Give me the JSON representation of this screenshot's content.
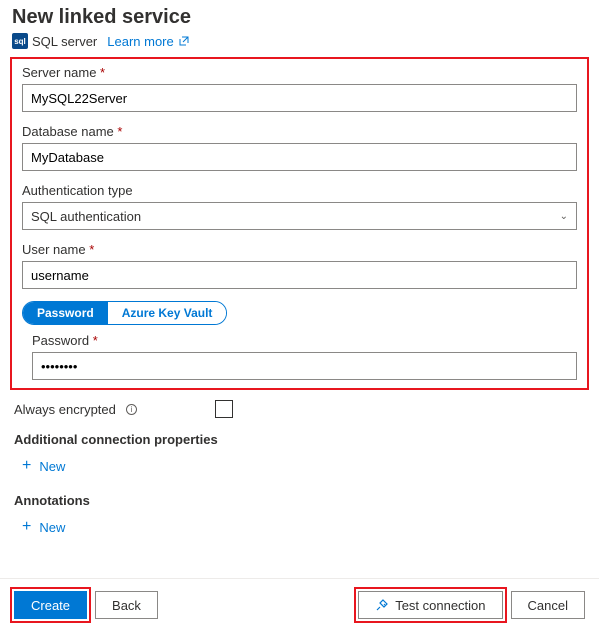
{
  "header": {
    "title": "New linked service",
    "subtitle": "SQL server",
    "learn_more": "Learn more"
  },
  "fields": {
    "server_name": {
      "label": "Server name",
      "value": "MySQL22Server"
    },
    "database_name": {
      "label": "Database name",
      "value": "MyDatabase"
    },
    "auth_type": {
      "label": "Authentication type",
      "value": "SQL authentication"
    },
    "user_name": {
      "label": "User name",
      "value": "username"
    },
    "password_tab": "Password",
    "akv_tab": "Azure Key Vault",
    "password": {
      "label": "Password",
      "value": "••••••••"
    }
  },
  "below": {
    "always_encrypted": "Always encrypted",
    "additional_props": "Additional connection properties",
    "annotations": "Annotations",
    "new": "New"
  },
  "footer": {
    "create": "Create",
    "back": "Back",
    "test": "Test connection",
    "cancel": "Cancel"
  }
}
